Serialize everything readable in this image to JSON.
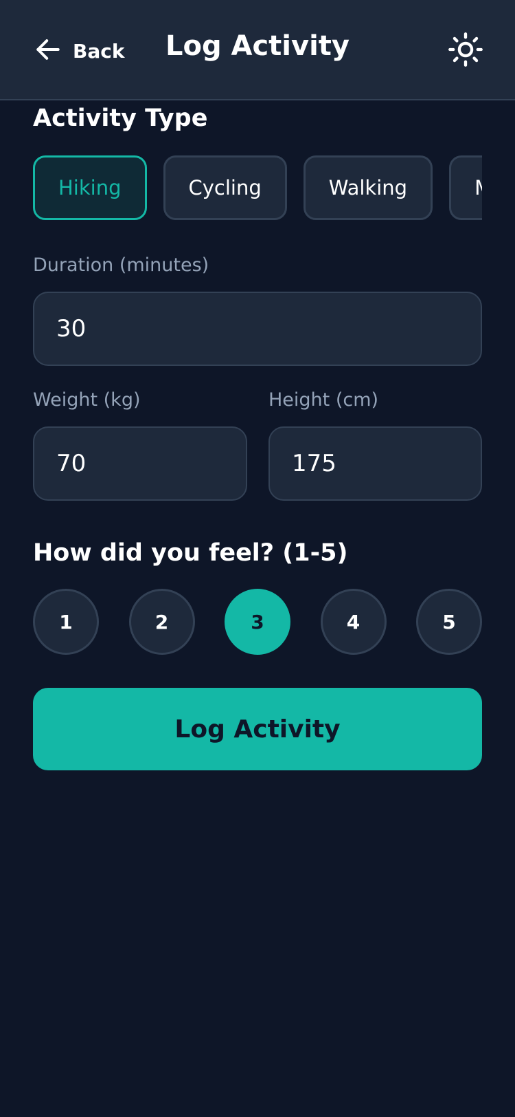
{
  "header": {
    "back_label": "Back",
    "title": "Log Activity",
    "theme_icon": "sun-icon",
    "back_icon": "arrow-left-icon"
  },
  "activity": {
    "section_title": "Activity Type",
    "options": [
      "Hiking",
      "Cycling",
      "Walking",
      "Marathon"
    ],
    "selected": "Hiking"
  },
  "form": {
    "duration_label": "Duration (minutes)",
    "duration_value": "30",
    "weight_label": "Weight (kg)",
    "weight_value": "70",
    "height_label": "Height (cm)",
    "height_value": "175"
  },
  "rating": {
    "title": "How did you feel? (1-5)",
    "options": [
      "1",
      "2",
      "3",
      "4",
      "5"
    ],
    "selected": "3"
  },
  "submit_label": "Log Activity",
  "colors": {
    "accent": "#14b8a6",
    "background": "#0e1628",
    "surface": "#1e293b",
    "border": "#334155",
    "muted_text": "#94a3b8"
  }
}
